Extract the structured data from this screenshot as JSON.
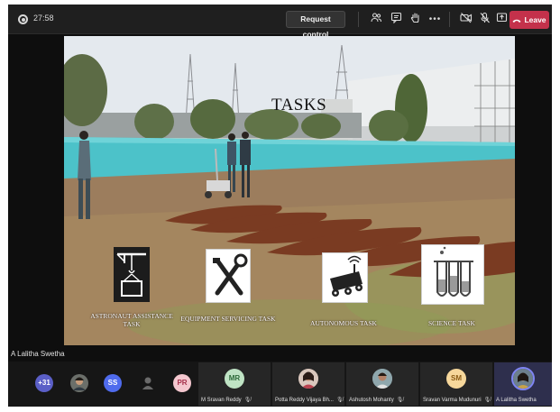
{
  "call": {
    "timer": "27:58",
    "request_control_label": "Request control",
    "leave_label": "Leave",
    "colors": {
      "leave": "#c4314b",
      "bar": "#1f1f1f"
    }
  },
  "toolbar_icons": [
    "people-icon",
    "chat-icon",
    "raise-hand-icon",
    "more-icon",
    "camera-off-icon",
    "mic-off-icon",
    "share-icon"
  ],
  "slide": {
    "title": "TASKS",
    "tasks": [
      {
        "caption": "ASTRONAUT ASSISTANCE TASK",
        "icon": "crane-box-icon"
      },
      {
        "caption": "EQUIPMENT SERVICING TASK",
        "icon": "tools-icon"
      },
      {
        "caption": "AUTONOMOUS TASK",
        "icon": "robot-rover-icon"
      },
      {
        "caption": "SCIENCE TASK",
        "icon": "test-tubes-icon"
      }
    ]
  },
  "presenter": {
    "name": "A Lalitha Swetha"
  },
  "participants": {
    "overflow_count": "+31",
    "small": [
      {
        "initials": "",
        "type": "photo"
      },
      {
        "initials": "SS",
        "type": "initials"
      },
      {
        "initials": "",
        "type": "silhouette"
      },
      {
        "initials": "PR",
        "type": "initials"
      }
    ],
    "tiles": [
      {
        "name": "M Sravan Reddy",
        "initials": "MR",
        "type": "initials"
      },
      {
        "name": "Potta Reddy Vijaya Bh...",
        "initials": "",
        "type": "photo"
      },
      {
        "name": "Ashutosh Mohanty",
        "initials": "",
        "type": "photo"
      },
      {
        "name": "Sravan Varma Mudunuri",
        "initials": "SM",
        "type": "initials"
      },
      {
        "name": "A Lalitha Swetha",
        "initials": "",
        "type": "photo"
      }
    ]
  }
}
